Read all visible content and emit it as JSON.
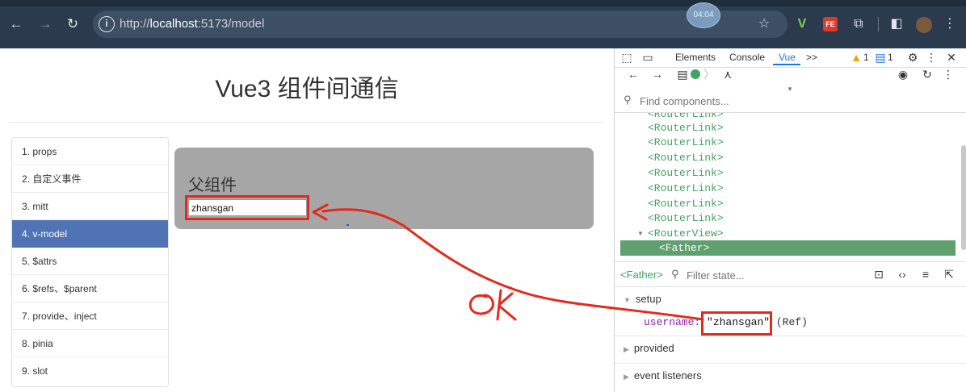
{
  "browser": {
    "url_prefix": "http://",
    "url_host": "localhost",
    "url_rest": ":5173/model",
    "clock": "04:04"
  },
  "app": {
    "title": "Vue3 组件间通信",
    "nav": [
      {
        "label": "1. props"
      },
      {
        "label": "2. 自定义事件"
      },
      {
        "label": "3. mitt"
      },
      {
        "label": "4. v-model"
      },
      {
        "label": "5. $attrs"
      },
      {
        "label": "6. $refs、$parent"
      },
      {
        "label": "7. provide、inject"
      },
      {
        "label": "8. pinia"
      },
      {
        "label": "9. slot"
      }
    ],
    "active_index": 3,
    "panel_title": "父组件",
    "input_value": "zhansgan"
  },
  "devtools": {
    "tabs": {
      "elements": "Elements",
      "console": "Console",
      "vue": "Vue",
      "more": ">>"
    },
    "warn_count": "1",
    "msg_count": "1",
    "find_placeholder": "Find components...",
    "tree": [
      "<RouterLink>",
      "<RouterLink>",
      "<RouterLink>",
      "<RouterLink>",
      "<RouterLink>",
      "<RouterLink>",
      "<RouterLink>",
      "<RouterLink>",
      "<RouterView>",
      "<Father>"
    ],
    "state_component": "<Father>",
    "filter_placeholder": "Filter state...",
    "sections": {
      "setup": "setup",
      "provided": "provided",
      "events": "event listeners"
    },
    "state": {
      "key": "username",
      "value": "\"zhansgan\"",
      "type": "(Ref)"
    }
  },
  "annotation": {
    "text": "Ok"
  },
  "colors": {
    "accent_nav": "#4f73b4",
    "highlight_red": "#e32a1e",
    "vue_green": "#42a364"
  }
}
